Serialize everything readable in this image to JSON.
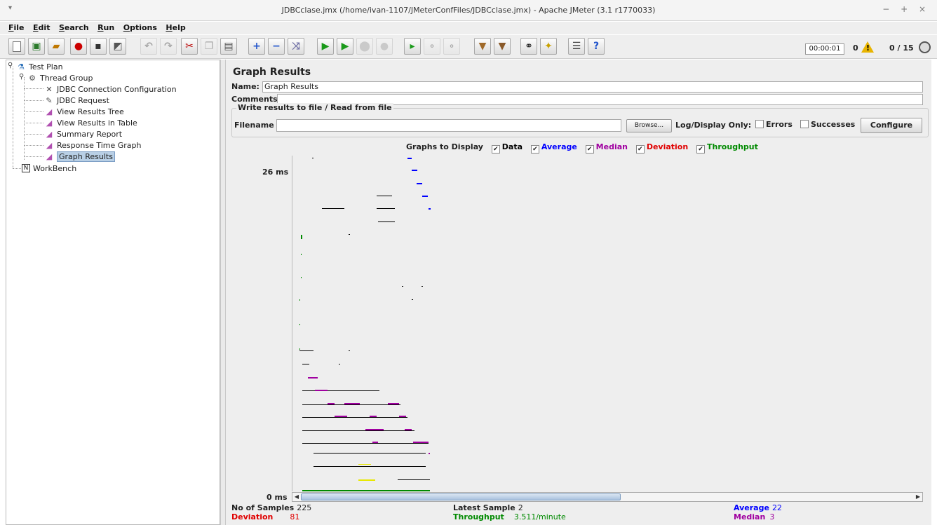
{
  "window": {
    "title": "JDBCclase.jmx (/home/ivan-1107/JMeterConfFiles/JDBCclase.jmx) - Apache JMeter (3.1 r1770033)",
    "menu_glyph": "▾",
    "controls": "− + ×"
  },
  "menubar": [
    "File",
    "Edit",
    "Search",
    "Run",
    "Options",
    "Help"
  ],
  "toolbar": {
    "elapsed": "00:00:01",
    "error_count": "0",
    "threads": "0 / 15"
  },
  "tree": {
    "root": "Test Plan",
    "thread_group": "Thread Group",
    "children": [
      "JDBC Connection Configuration",
      "JDBC Request",
      "View Results Tree",
      "View Results in Table",
      "Summary Report",
      "Response Time Graph",
      "Graph Results"
    ],
    "selected": "Graph Results",
    "workbench": "WorkBench"
  },
  "panel": {
    "title": "Graph Results",
    "name_label": "Name:",
    "name_value": "Graph Results",
    "comments_label": "Comments:",
    "comments_value": "",
    "file_group_legend": "Write results to file / Read from file",
    "filename_label": "Filename",
    "filename_value": "",
    "browse_button": "Browse...",
    "log_display_label": "Log/Display Only:",
    "errors_label": "Errors",
    "successes_label": "Successes",
    "configure_button": "Configure"
  },
  "graphs_to_display": {
    "label": "Graphs to Display",
    "items": [
      {
        "label": "Data",
        "color": "#000000",
        "checked": true
      },
      {
        "label": "Average",
        "color": "#0000ff",
        "checked": true
      },
      {
        "label": "Median",
        "color": "#a000a0",
        "checked": true
      },
      {
        "label": "Deviation",
        "color": "#e00000",
        "checked": true
      },
      {
        "label": "Throughput",
        "color": "#008a00",
        "checked": true
      }
    ]
  },
  "graph": {
    "y_max_label": "26 ms",
    "y_min_label": "0 ms"
  },
  "stats": {
    "samples_label": "No of Samples",
    "samples_value": "225",
    "latest_label": "Latest Sample",
    "latest_value": "2",
    "average_label": "Average",
    "average_value": "22",
    "deviation_label": "Deviation",
    "deviation_value": "81",
    "throughput_label": "Throughput",
    "throughput_value": "3.511/minute",
    "median_label": "Median",
    "median_value": "3"
  }
}
